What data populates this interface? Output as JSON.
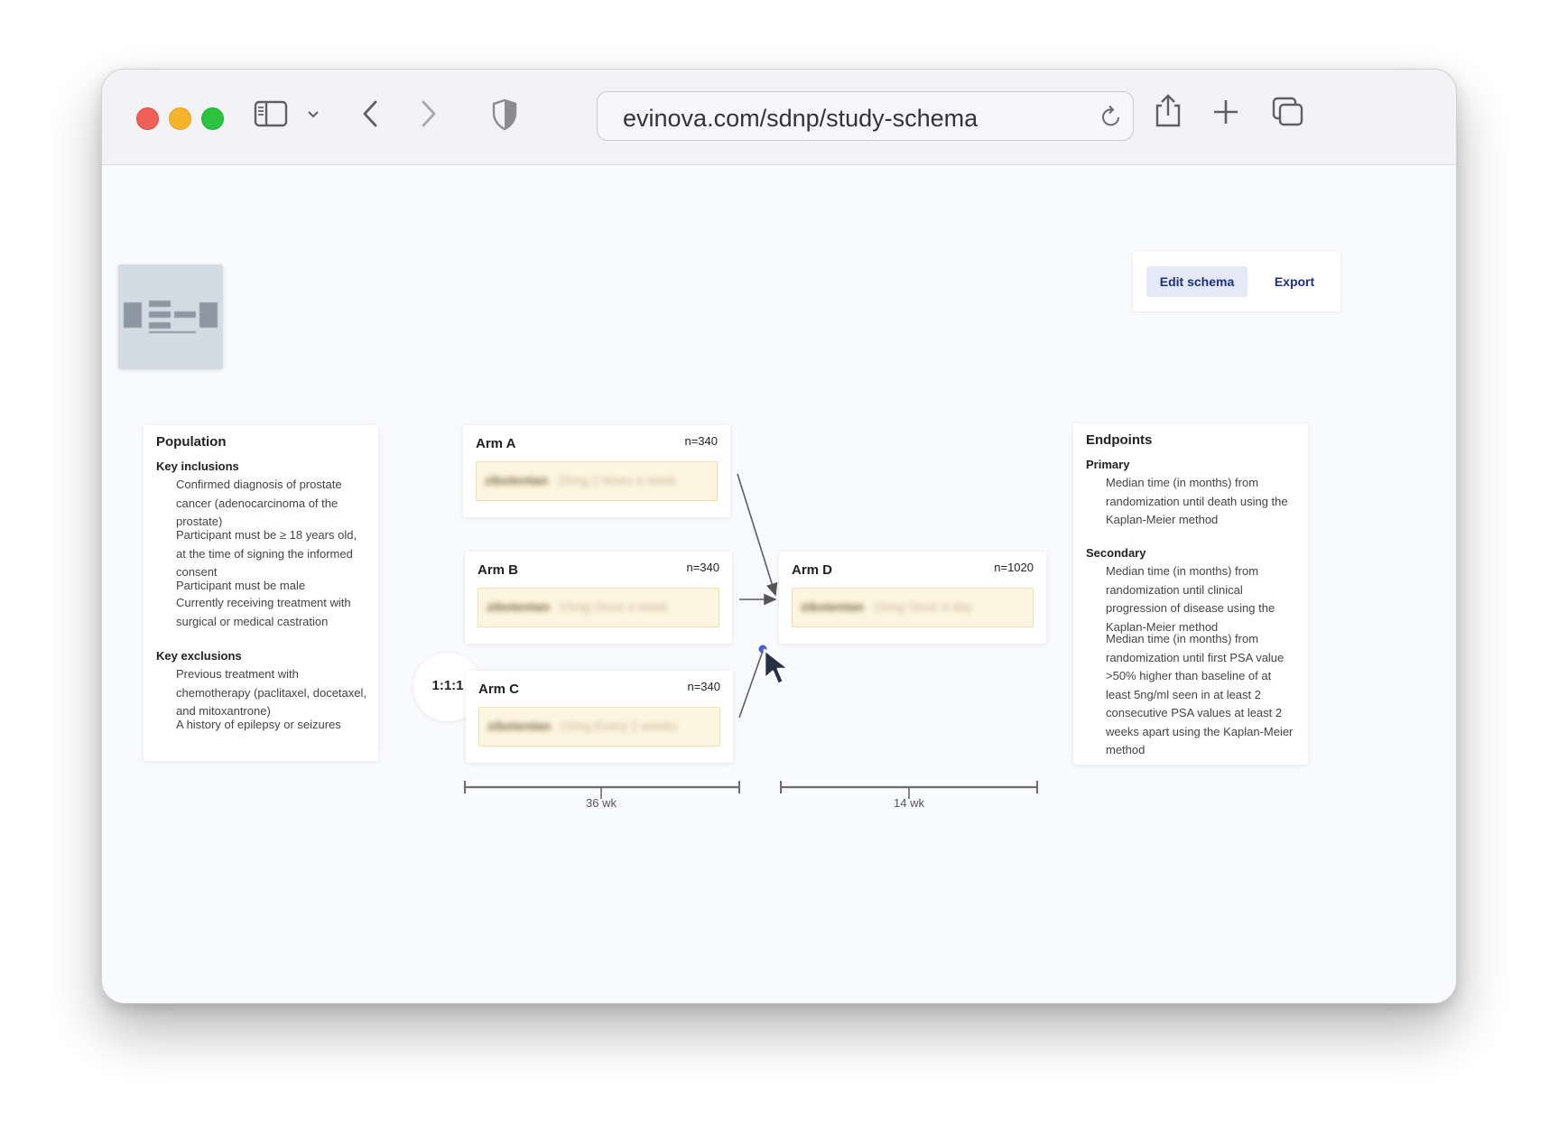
{
  "browser": {
    "url": "evinova.com/sdnp/study-schema",
    "traffic_lights": {
      "close": "#f25f57",
      "minimize": "#f6b42b",
      "zoom": "#2cc43f"
    }
  },
  "toolbar_actions": {
    "edit_schema": "Edit schema",
    "export": "Export"
  },
  "population": {
    "title": "Population",
    "inclusions_title": "Key inclusions",
    "inclusions": [
      "Confirmed diagnosis of prostate cancer (adenocarcinoma of the prostate)",
      "Participant must be ≥ 18 years old, at the time of signing the informed consent",
      "Participant must be male",
      "Currently receiving treatment with surgical or medical castration"
    ],
    "exclusions_title": "Key exclusions",
    "exclusions": [
      "Previous treatment with chemotherapy (paclitaxel, docetaxel, and mitoxantrone)",
      "A history of epilepsy or seizures"
    ]
  },
  "randomization": {
    "ratio": "1:1:1"
  },
  "arms": {
    "a": {
      "label": "Arm A",
      "n": "n=340",
      "drug": "zibotentan",
      "dose": "15mg 2 times a week"
    },
    "b": {
      "label": "Arm B",
      "n": "n=340",
      "drug": "zibotentan",
      "dose": "15mg Once a week"
    },
    "c": {
      "label": "Arm C",
      "n": "n=340",
      "drug": "zibotentan",
      "dose": "15mg Every 2 weeks"
    },
    "d": {
      "label": "Arm D",
      "n": "n=1020",
      "drug": "zibotentan",
      "dose": "15mg Once a day"
    }
  },
  "timeline": {
    "phase1": "36 wk",
    "phase2": "14 wk"
  },
  "endpoints": {
    "title": "Endpoints",
    "primary_title": "Primary",
    "primary": "Median time (in months) from randomization until death using the Kaplan-Meier method",
    "secondary_title": "Secondary",
    "secondary": [
      "Median time (in months) from randomization until clinical progression of disease using the Kaplan-Meier method",
      "Median time (in months) from randomization until first PSA value >50% higher than baseline of at least 5ng/ml seen in at least 2 consecutive PSA values at least 2 weeks apart using the Kaplan-Meier method"
    ]
  },
  "icons": [
    "sidebar-icon",
    "chevron-down-icon",
    "back-icon",
    "forward-icon",
    "shield-icon",
    "reload-icon",
    "share-icon",
    "new-tab-icon",
    "tabs-overview-icon",
    "cursor-icon",
    "minimap-icon"
  ]
}
